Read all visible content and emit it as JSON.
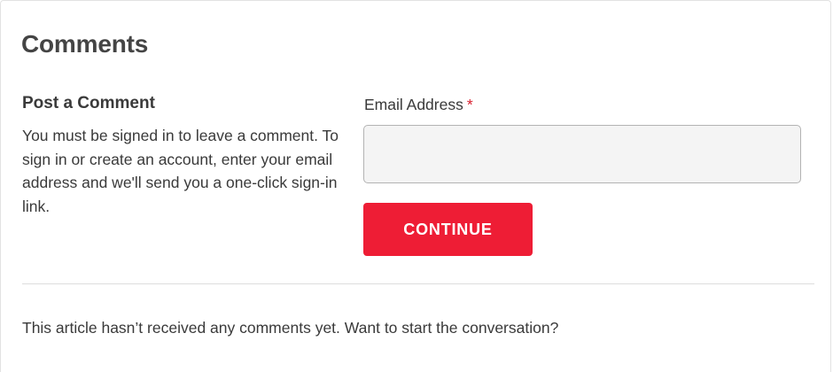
{
  "comments": {
    "title": "Comments",
    "post": {
      "title": "Post a Comment",
      "description": "You must be signed in to leave a comment. To sign in or create an account, enter your email address and we'll send you a one-click sign-in link."
    },
    "form": {
      "email_label": "Email Address",
      "required_mark": "*",
      "email_value": "",
      "continue_label": "CONTINUE"
    },
    "empty_message": "This article hasn’t received any comments yet. Want to start the conversation?"
  },
  "colors": {
    "accent": "#ee1d35",
    "required": "#d8202f",
    "text": "#3a3a3a",
    "input_background": "#f4f4f4",
    "divider": "#dddddd"
  }
}
